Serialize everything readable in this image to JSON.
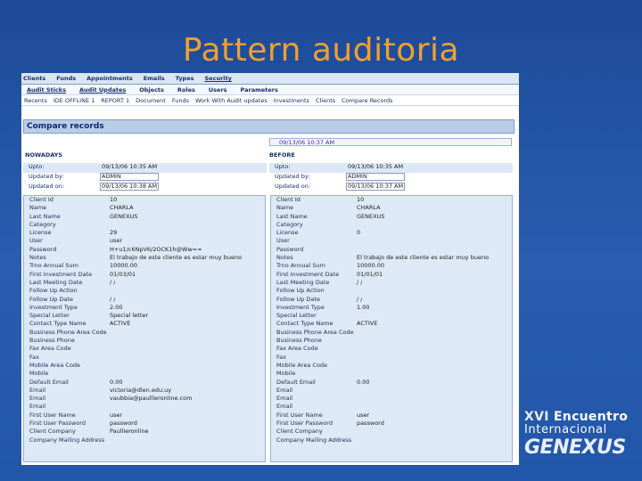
{
  "slide": {
    "title": "Pattern auditoria"
  },
  "nav_primary": [
    "Clients",
    "Funds",
    "Appointments",
    "Emails",
    "Types",
    "Security"
  ],
  "nav_primary_active": "Security",
  "nav_secondary": [
    "Audit Sticks",
    "Audit Updates",
    "Objects",
    "Roles",
    "Users",
    "Parameters"
  ],
  "breadcrumb": [
    "Recents",
    "IDE OFFLINE 1",
    "REPORT 1",
    "Document",
    "Funds",
    "Work With Audit updates",
    "Investments",
    "Clients",
    "Compare Records"
  ],
  "panel": {
    "title": "Compare records",
    "date_line": "09/13/06 10:37 AM"
  },
  "left": {
    "heading": "NOWADAYS",
    "meta": [
      {
        "label": "Upto:",
        "value": "09/13/06 10:35 AM"
      },
      {
        "label": "Updated by:",
        "value": "ADMIN"
      },
      {
        "label": "Updated on:",
        "value": "09/13/06 10:38 AM"
      }
    ],
    "fields": [
      {
        "label": "Client Id",
        "value": "10"
      },
      {
        "label": "Name",
        "value": "CHARLA"
      },
      {
        "label": "Last Name",
        "value": "GENEXUS"
      },
      {
        "label": "Category",
        "value": ""
      },
      {
        "label": "License",
        "value": "29"
      },
      {
        "label": "User",
        "value": "user"
      },
      {
        "label": "Password",
        "value": "H+u1/c6NpV6/2OCK1h@Ww=="
      },
      {
        "label": "Notes",
        "value": "El trabajo de este cliente es estar muy bueno"
      },
      {
        "label": "Trno Annual Sum",
        "value": "10000.00"
      },
      {
        "label": "First Investment Date",
        "value": "01/03/01"
      },
      {
        "label": "Last Meeting Date",
        "value": "/ /"
      },
      {
        "label": "Follow Up Action",
        "value": ""
      },
      {
        "label": "Follow Up Date",
        "value": "/ /"
      },
      {
        "label": "Investment Type",
        "value": "2.00"
      },
      {
        "label": "Special Letter",
        "value": "Special letter"
      },
      {
        "label": "Contact Type Name",
        "value": "ACTIVE"
      },
      {
        "label": "Business Phone Area Code",
        "value": ""
      },
      {
        "label": "Business Phone",
        "value": ""
      },
      {
        "label": "Fax Area Code",
        "value": ""
      },
      {
        "label": "Fax",
        "value": ""
      },
      {
        "label": "Mobile Area Code",
        "value": ""
      },
      {
        "label": "Mobile",
        "value": ""
      },
      {
        "label": "Default Email",
        "value": "0.00"
      },
      {
        "label": "Email",
        "value": "victoria@dlen.edu.uy"
      },
      {
        "label": "Email",
        "value": "vaubbia@paullieronline.com"
      },
      {
        "label": "Email",
        "value": ""
      },
      {
        "label": "First User Name",
        "value": "user"
      },
      {
        "label": "First User Password",
        "value": "password"
      },
      {
        "label": "Client Company",
        "value": "Paullieronline"
      },
      {
        "label": "Company Mailing Address",
        "value": ""
      }
    ]
  },
  "right": {
    "heading": "BEFORE",
    "meta": [
      {
        "label": "Upto:",
        "value": "09/13/06 10:35 AM"
      },
      {
        "label": "Updated by:",
        "value": "ADMIN"
      },
      {
        "label": "Updated on:",
        "value": "09/13/06 10:37 AM"
      }
    ],
    "fields": [
      {
        "label": "Client Id",
        "value": "10"
      },
      {
        "label": "Name",
        "value": "CHARLA"
      },
      {
        "label": "Last Name",
        "value": "GENEXUS"
      },
      {
        "label": "Category",
        "value": ""
      },
      {
        "label": "License",
        "value": "0"
      },
      {
        "label": "User",
        "value": ""
      },
      {
        "label": "Password",
        "value": ""
      },
      {
        "label": "Notes",
        "value": "El trabajo de este cliente es estar muy bueno"
      },
      {
        "label": "Trno Annual Sum",
        "value": "10000.00"
      },
      {
        "label": "First Investment Date",
        "value": "01/01/01"
      },
      {
        "label": "Last Meeting Date",
        "value": "/ /"
      },
      {
        "label": "Follow Up Action",
        "value": ""
      },
      {
        "label": "Follow Up Date",
        "value": "/ /"
      },
      {
        "label": "Investment Type",
        "value": "1.00"
      },
      {
        "label": "Special Letter",
        "value": ""
      },
      {
        "label": "Contact Type Name",
        "value": "ACTIVE"
      },
      {
        "label": "Business Phone Area Code",
        "value": ""
      },
      {
        "label": "Business Phone",
        "value": ""
      },
      {
        "label": "Fax Area Code",
        "value": ""
      },
      {
        "label": "Fax",
        "value": ""
      },
      {
        "label": "Mobile Area Code",
        "value": ""
      },
      {
        "label": "Mobile",
        "value": ""
      },
      {
        "label": "Default Email",
        "value": "0.00"
      },
      {
        "label": "Email",
        "value": ""
      },
      {
        "label": "Email",
        "value": ""
      },
      {
        "label": "Email",
        "value": ""
      },
      {
        "label": "First User Name",
        "value": "user"
      },
      {
        "label": "First User Password",
        "value": "password"
      },
      {
        "label": "Client Company",
        "value": ""
      },
      {
        "label": "Company Mailing Address",
        "value": ""
      }
    ]
  },
  "logo": {
    "line1_prefix": "XVI",
    "line1_rest": "Encuentro",
    "line2": "Internacional",
    "brand": "GENEXUS"
  },
  "colors": {
    "title": "#f0a030",
    "background": "#1f4e9f",
    "panel_header": "#b9cde9",
    "field_bg": "#dde9f6"
  }
}
